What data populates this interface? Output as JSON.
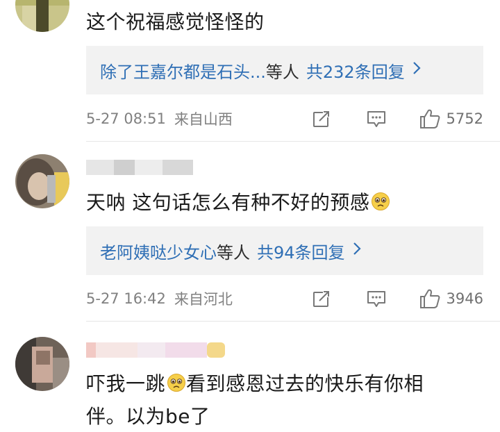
{
  "comments": [
    {
      "text": "这个祝福感觉怪怪的",
      "replies": {
        "names": "除了王嘉尔都是石头...",
        "suffix": "等人",
        "total": "共232条回复"
      },
      "time": "5-27 08:51",
      "source": "来自山西",
      "likes": "5752"
    },
    {
      "text": "天呐 这句话怎么有种不好的预感",
      "replies": {
        "names": "老阿姨哒少女心",
        "suffix": "等人",
        "total": "共94条回复"
      },
      "time": "5-27 16:42",
      "source": "来自河北",
      "likes": "3946"
    },
    {
      "text_part1": "吓我一跳",
      "text_part2": "看到感恩过去的快乐有你相",
      "text_line2": "伴。以为be了"
    }
  ],
  "icons": {
    "share": "share-icon",
    "comment": "comment-icon",
    "like": "thumbs-up-icon",
    "emoji": "pleading-face-emoji",
    "chevron": "chevron-right-icon"
  },
  "colors": {
    "link": "#2f6fb5",
    "meta": "#808080",
    "reply_bg": "#f2f2f2"
  }
}
